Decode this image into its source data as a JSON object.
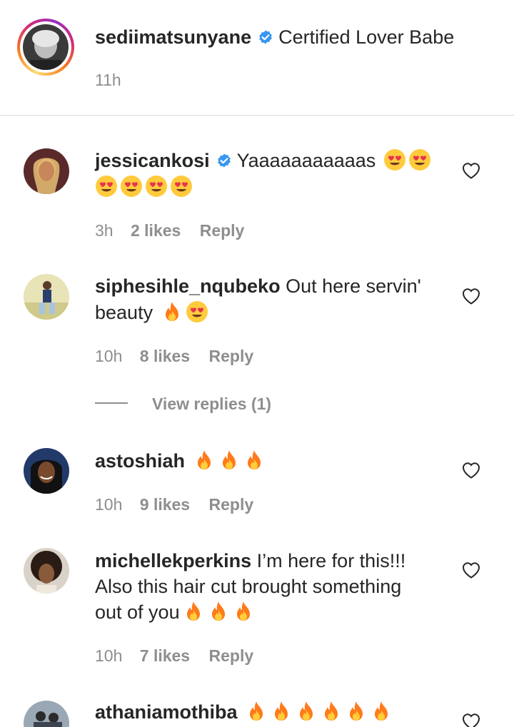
{
  "caption": {
    "username": "sediimatsunyane",
    "verified": true,
    "text": "Certified Lover Babe",
    "time": "11h"
  },
  "comments": [
    {
      "username": "jessicankosi",
      "verified": true,
      "line1": "Yaaaaaaaaaaas",
      "line1_emojis": [
        "heart-eyes-emoji",
        "heart-eyes-emoji"
      ],
      "line2_emojis": [
        "heart-eyes-emoji",
        "heart-eyes-emoji",
        "heart-eyes-emoji",
        "heart-eyes-emoji"
      ],
      "time": "3h",
      "likes": "2 likes",
      "reply": "Reply"
    },
    {
      "username": "siphesihle_nqubeko",
      "line1": "Out here servin'",
      "line2": "beauty",
      "line2_emojis": [
        "fire-emoji",
        "heart-eyes-emoji"
      ],
      "time": "10h",
      "likes": "8 likes",
      "reply": "Reply",
      "view_replies": "View replies (1)"
    },
    {
      "username": "astoshiah",
      "line1_emojis": [
        "fire-emoji",
        "fire-emoji",
        "fire-emoji"
      ],
      "time": "10h",
      "likes": "9 likes",
      "reply": "Reply"
    },
    {
      "username": "michellekperkins",
      "line1": "I’m here for this!!!",
      "line2": "Also this hair cut brought something",
      "line3": "out of you",
      "line3_emojis": [
        "fire-emoji",
        "fire-emoji",
        "fire-emoji"
      ],
      "time": "10h",
      "likes": "7 likes",
      "reply": "Reply"
    },
    {
      "username": "athaniamothiba",
      "line1_emojis": [
        "fire-emoji",
        "fire-emoji",
        "fire-emoji",
        "fire-emoji",
        "fire-emoji",
        "fire-emoji"
      ]
    }
  ],
  "icons": {
    "verified": "verified-badge-icon",
    "like": "heart-outline-icon"
  },
  "colors": {
    "text": "#262626",
    "meta": "#8e8e8e",
    "verified_blue": "#3897f0",
    "story_ring": "#d62976"
  }
}
